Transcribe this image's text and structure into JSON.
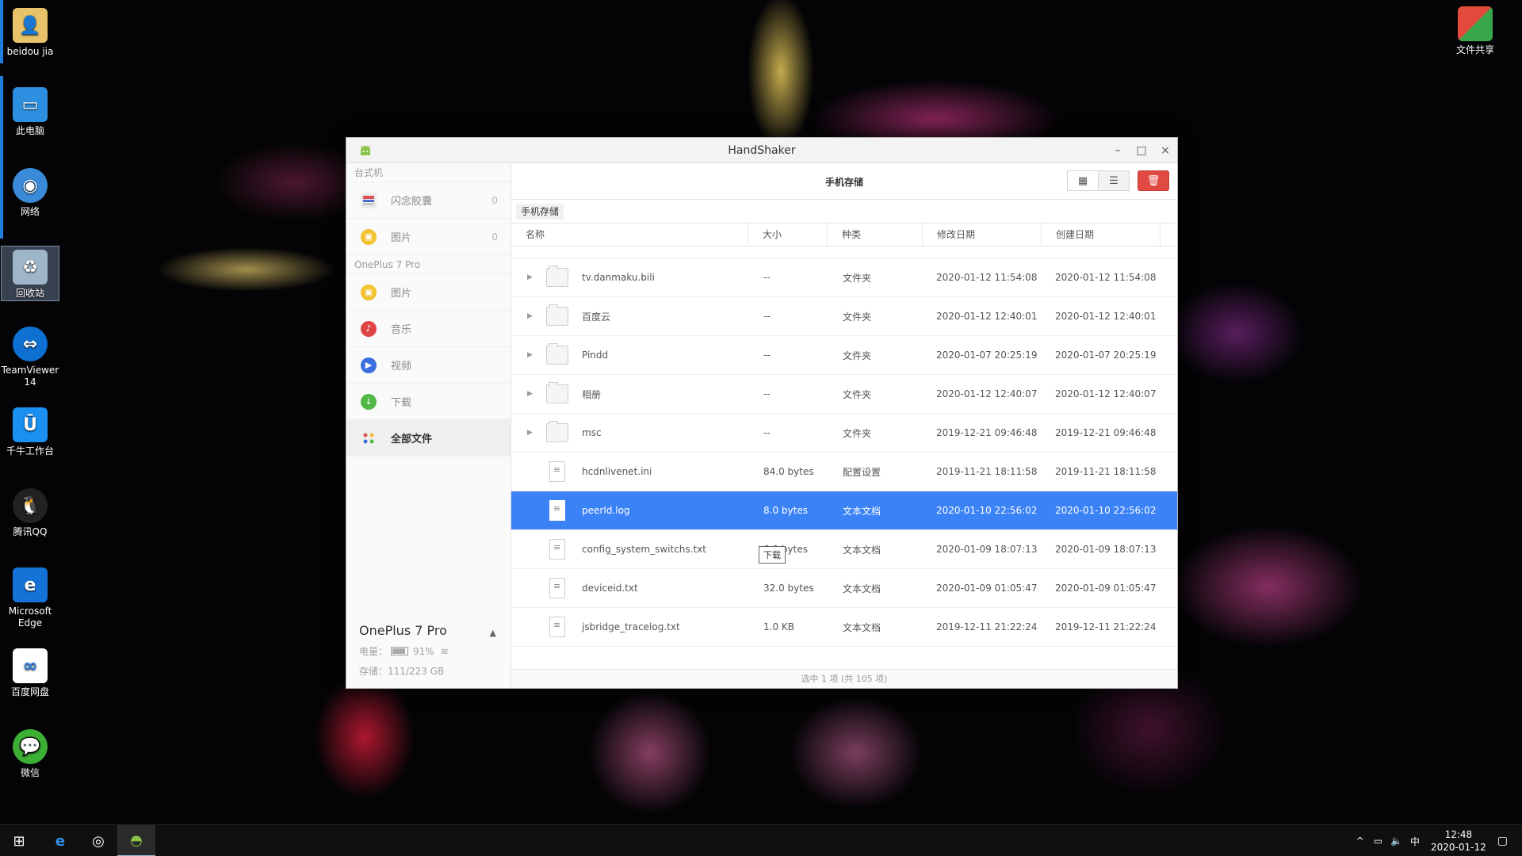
{
  "desktop": {
    "icons": [
      {
        "label": "beidou jia",
        "icon": "user-folder-icon"
      },
      {
        "label": "此电脑",
        "icon": "computer-icon"
      },
      {
        "label": "网络",
        "icon": "network-icon"
      },
      {
        "label": "回收站",
        "icon": "recycle-bin-icon"
      },
      {
        "label": "TeamViewer 14",
        "icon": "teamviewer-icon"
      },
      {
        "label": "千牛工作台",
        "icon": "qianniu-icon"
      },
      {
        "label": "腾讯QQ",
        "icon": "qq-icon"
      },
      {
        "label": "Microsoft Edge",
        "icon": "edge-icon"
      },
      {
        "label": "百度网盘",
        "icon": "baidu-netdisk-icon"
      },
      {
        "label": "微信",
        "icon": "wechat-icon"
      }
    ],
    "share_icon": {
      "label": "文件共享",
      "icon": "shield-icon"
    }
  },
  "window": {
    "title": "HandShaker",
    "minimize": "–",
    "maximize": "□",
    "close": "×"
  },
  "sidebar": {
    "section_desktop": "台式机",
    "desktop_items": [
      {
        "label": "闪念胶囊",
        "count": "0",
        "icon": "flash-capsule-icon",
        "color": "#e05050"
      },
      {
        "label": "图片",
        "count": "0",
        "icon": "picture-icon",
        "color": "#f2c230"
      }
    ],
    "section_phone": "OnePlus 7 Pro",
    "phone_items": [
      {
        "label": "图片",
        "icon": "picture-icon",
        "color": "#f2c230"
      },
      {
        "label": "音乐",
        "icon": "music-icon",
        "color": "#e04545"
      },
      {
        "label": "视频",
        "icon": "video-icon",
        "color": "#3b6fe0"
      },
      {
        "label": "下载",
        "icon": "download-icon",
        "color": "#52b848"
      },
      {
        "label": "全部文件",
        "icon": "all-files-icon",
        "color": "#ffffff"
      }
    ],
    "tooltip": "下载",
    "device": {
      "name": "OnePlus 7 Pro",
      "battery_label": "电量：",
      "battery_value": "91%",
      "battery_level": 0.91,
      "storage_label": "存储：",
      "storage_value": "111/223 GB"
    }
  },
  "main": {
    "header_title": "手机存储",
    "breadcrumb": "手机存储",
    "columns": [
      "名称",
      "大小",
      "种类",
      "修改日期",
      "创建日期"
    ],
    "rows": [
      {
        "name": "tv.danmaku.bili",
        "size": "--",
        "type": "文件夹",
        "modified": "2020-01-12 11:54:08",
        "created": "2020-01-12 11:54:08",
        "kind": "folder"
      },
      {
        "name": "百度云",
        "size": "--",
        "type": "文件夹",
        "modified": "2020-01-12 12:40:01",
        "created": "2020-01-12 12:40:01",
        "kind": "folder"
      },
      {
        "name": "Pindd",
        "size": "--",
        "type": "文件夹",
        "modified": "2020-01-07 20:25:19",
        "created": "2020-01-07 20:25:19",
        "kind": "folder"
      },
      {
        "name": "相册",
        "size": "--",
        "type": "文件夹",
        "modified": "2020-01-12 12:40:07",
        "created": "2020-01-12 12:40:07",
        "kind": "folder"
      },
      {
        "name": "msc",
        "size": "--",
        "type": "文件夹",
        "modified": "2019-12-21 09:46:48",
        "created": "2019-12-21 09:46:48",
        "kind": "folder"
      },
      {
        "name": "hcdnlivenet.ini",
        "size": "84.0 bytes",
        "type": "配置设置",
        "modified": "2019-11-21 18:11:58",
        "created": "2019-11-21 18:11:58",
        "kind": "config"
      },
      {
        "name": "peerId.log",
        "size": "8.0 bytes",
        "type": "文本文档",
        "modified": "2020-01-10 22:56:02",
        "created": "2020-01-10 22:56:02",
        "kind": "doc",
        "selected": true
      },
      {
        "name": "config_system_switchs.txt",
        "size": "6.0 bytes",
        "type": "文本文档",
        "modified": "2020-01-09 18:07:13",
        "created": "2020-01-09 18:07:13",
        "kind": "doc"
      },
      {
        "name": "deviceid.txt",
        "size": "32.0 bytes",
        "type": "文本文档",
        "modified": "2020-01-09 01:05:47",
        "created": "2020-01-09 01:05:47",
        "kind": "doc"
      },
      {
        "name": "jsbridge_tracelog.txt",
        "size": "1.0 KB",
        "type": "文本文档",
        "modified": "2019-12-11 21:22:24",
        "created": "2019-12-11 21:22:24",
        "kind": "doc"
      }
    ],
    "status": "选中 1 项 (共 105 项)"
  },
  "taskbar": {
    "time": "12:48",
    "date": "2020-01-12",
    "ime": "中",
    "accent": "#3b82f6"
  }
}
